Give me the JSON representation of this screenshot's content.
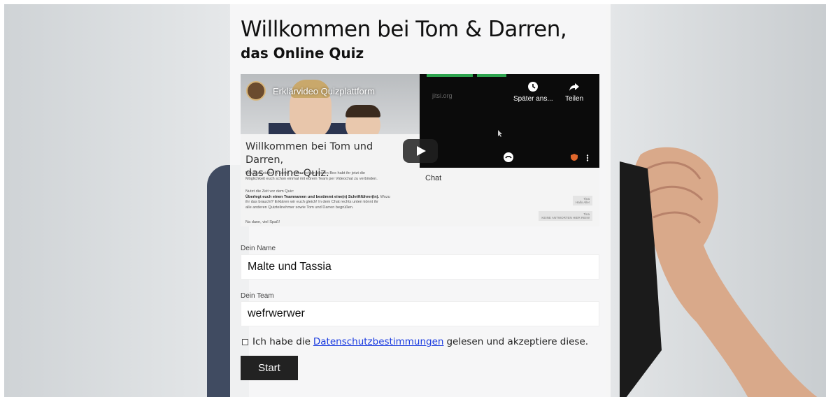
{
  "header": {
    "title": "Willkommen bei Tom & Darren,",
    "subtitle": "das Online Quiz"
  },
  "video": {
    "channel_title": "Erklärvideo Quizplattform",
    "heading_line1": "Willkommen bei Tom und Darren,",
    "heading_line2": "das Online-Quiz.",
    "para1_line1": "Das Quiz startet in Kürze. In der rechten oberen Box habt ihr jetzt die",
    "para1_line2": "Möglichkeit euch schon einmal mit eurem Team per Videochat zu verbinden.",
    "para2_line1": "Nutzt die Zeit vor dem Quiz:",
    "para2_line2_bold": "Überlegt euch einen Teamnamen und bestimmt eine(n) Schriftführer(in).",
    "para2_line2_rest": " Wozu",
    "para2_line3": "ihr das braucht? Erklären wir euch gleich! In dem Chat rechts unten könnt ihr",
    "para2_line4": "alle anderen Quizteilnehmer sowie Tom und Darren begrüßen.",
    "para3": "Na dann, viel Spaß!",
    "jitsi_label": "jitsi.org",
    "watch_later_label": "Später ans...",
    "share_label": "Teilen",
    "chat_title": "Chat",
    "chat_msg1_name": "Tina",
    "chat_msg1_text": "Hallo Alle!",
    "chat_msg2_name": "Tina",
    "chat_msg2_text": "KEINE ANTWORTEN HIER REIN!"
  },
  "form": {
    "name_label": "Dein Name",
    "name_value": "Malte und Tassia",
    "team_label": "Dein Team",
    "team_value": "wefrwerwer",
    "consent_before": "Ich habe die",
    "consent_link": "Datenschutzbestimmungen",
    "consent_after": "gelesen und akzeptiere diese.",
    "start_label": "Start"
  },
  "colors": {
    "button_bg": "#222222",
    "link": "#1a3be0",
    "panel_bg": "#f7f7f7"
  }
}
